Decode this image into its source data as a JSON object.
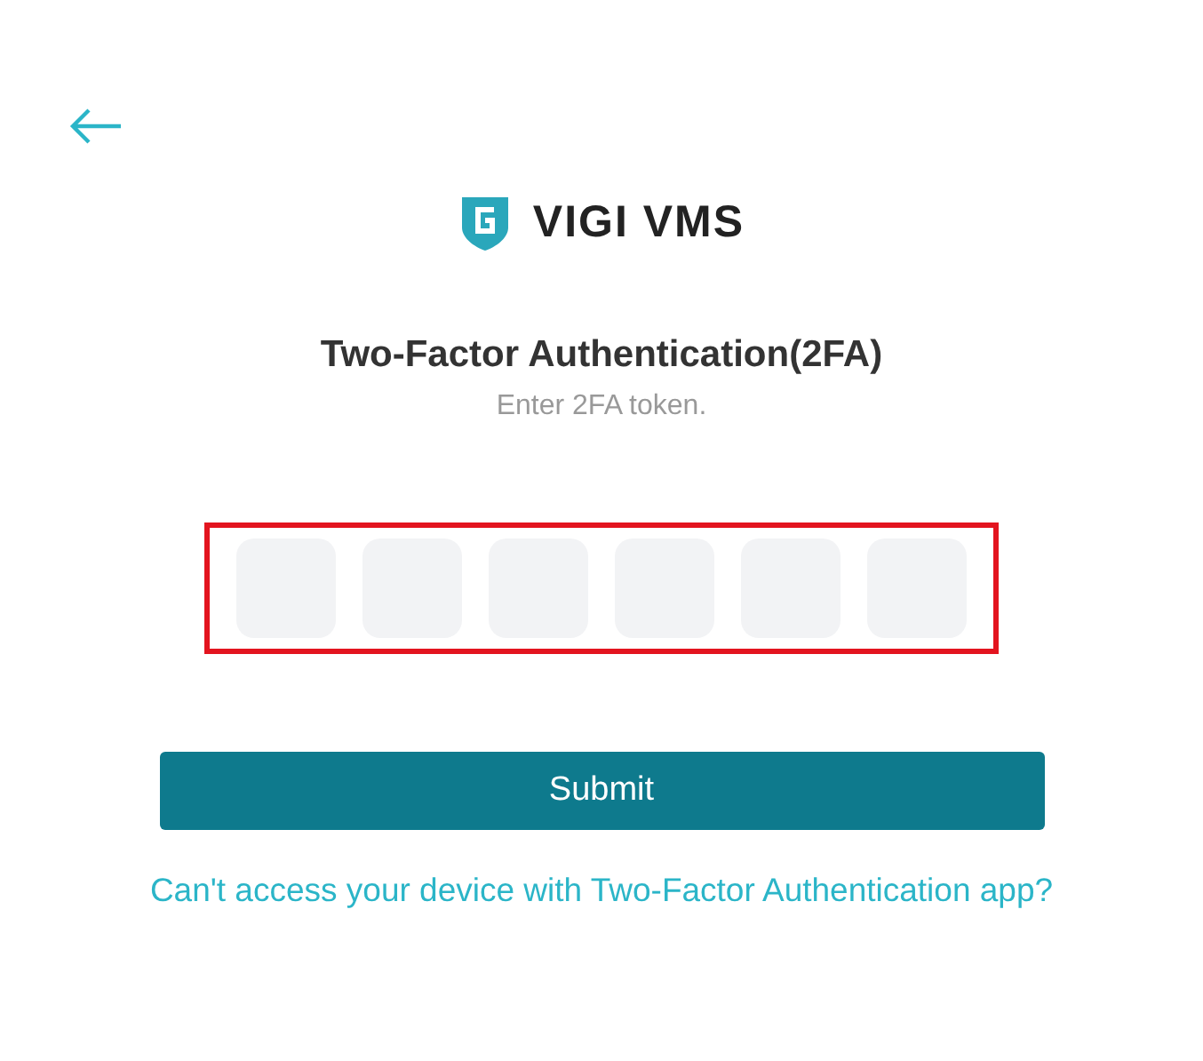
{
  "back_button": {
    "kind": "arrow"
  },
  "logo": {
    "text": "VIGI VMS"
  },
  "title": "Two-Factor Authentication(2FA)",
  "subtitle": "Enter 2FA token.",
  "token_group": {
    "highlighted": true,
    "boxes": [
      {
        "kind": "digit"
      },
      {
        "kind": "digit"
      },
      {
        "kind": "digit"
      },
      {
        "kind": "digit"
      },
      {
        "kind": "digit"
      },
      {
        "kind": "digit"
      }
    ]
  },
  "submit_button": "Submit",
  "help_link": "Can't access your device with Two-Factor Authentication app?"
}
